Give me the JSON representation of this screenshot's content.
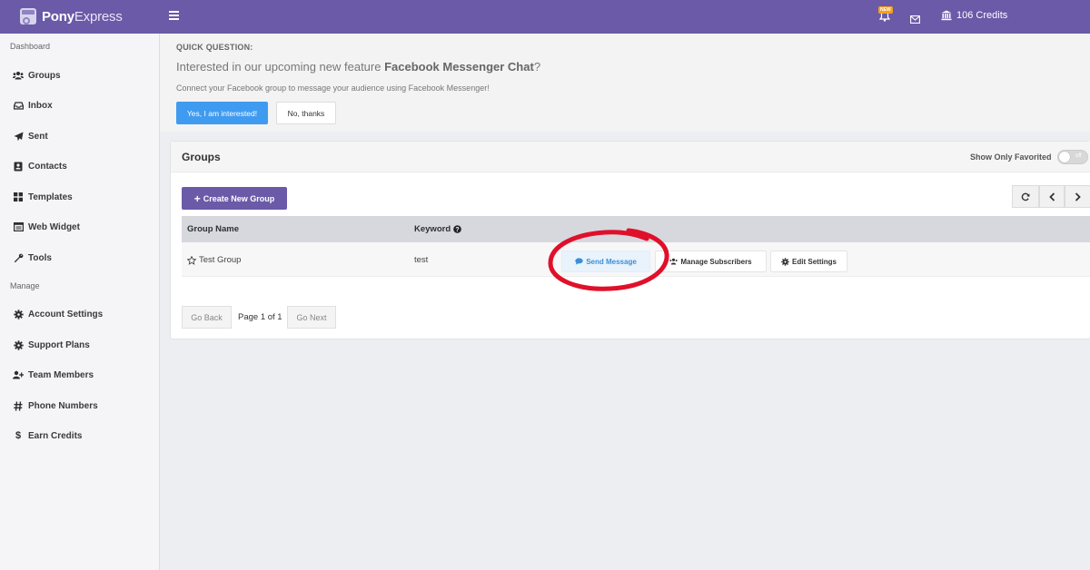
{
  "app": {
    "brand_bold": "Pony",
    "brand_light": "Express",
    "new_badge": "NEW",
    "credits": "106 Credits"
  },
  "sidebar": {
    "section_dashboard": "Dashboard",
    "section_manage": "Manage",
    "items": [
      {
        "label": "Groups",
        "icon": "users-icon"
      },
      {
        "label": "Inbox",
        "icon": "inbox-icon"
      },
      {
        "label": "Sent",
        "icon": "paper-plane-icon"
      },
      {
        "label": "Contacts",
        "icon": "address-book-icon"
      },
      {
        "label": "Templates",
        "icon": "grid-icon"
      },
      {
        "label": "Web Widget",
        "icon": "window-icon"
      },
      {
        "label": "Tools",
        "icon": "wrench-icon"
      },
      {
        "label": "Account Settings",
        "icon": "gear-icon"
      },
      {
        "label": "Support Plans",
        "icon": "gear-icon"
      },
      {
        "label": "Team Members",
        "icon": "user-plus-icon"
      },
      {
        "label": "Phone Numbers",
        "icon": "hash-icon"
      },
      {
        "label": "Earn Credits",
        "icon": "dollar-icon"
      }
    ]
  },
  "banner": {
    "heading": "QUICK QUESTION:",
    "question_prefix": "Interested in our upcoming new feature ",
    "question_feature": "Facebook Messenger Chat",
    "question_suffix": "?",
    "subtext": "Connect your Facebook group to message your audience using Facebook Messenger!",
    "yes_label": "Yes, I am interested!",
    "no_label": "No, thanks"
  },
  "groups": {
    "title": "Groups",
    "favorites_label": "Show Only Favorited",
    "toggle_state": "off",
    "create_label": "Create New Group",
    "columns": {
      "name": "Group Name",
      "keyword": "Keyword"
    },
    "rows": [
      {
        "name": "Test Group",
        "keyword": "test",
        "send_label": "Send Message",
        "manage_label": "Manage Subscribers",
        "edit_label": "Edit Settings"
      }
    ],
    "pager": {
      "back_label": "Go Back",
      "page_text": "Page 1 of 1",
      "next_label": "Go Next"
    }
  },
  "colors": {
    "brand": "#6a5aa8",
    "primary": "#3f9bf0",
    "annotation": "#e0102a"
  }
}
